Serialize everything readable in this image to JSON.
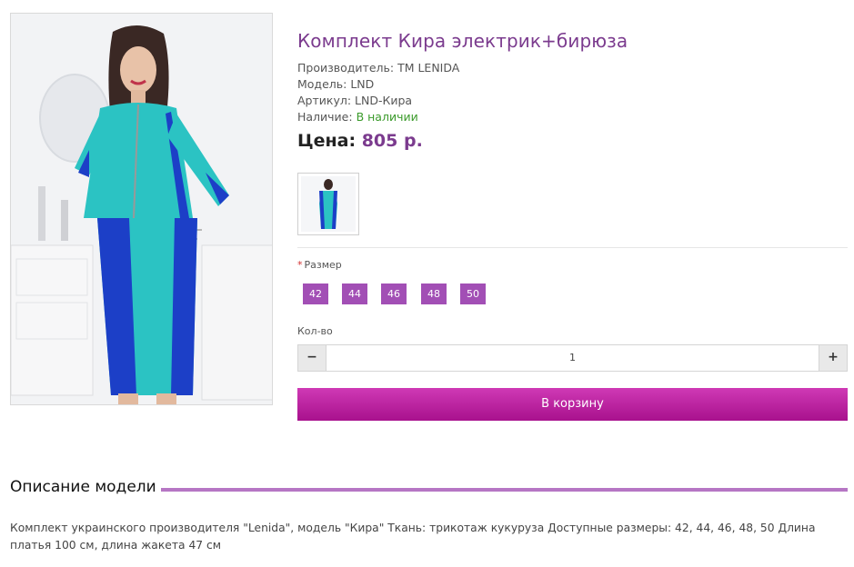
{
  "product": {
    "title": "Комплект Кира электрик+бирюза",
    "manufacturer_label": "Производитель:",
    "manufacturer": "TM LENIDA",
    "model_label": "Модель:",
    "model": "LND",
    "sku_label": "Артикул:",
    "sku": "LND-Кира",
    "availability_label": "Наличие:",
    "availability": "В наличии",
    "price_label": "Цена:",
    "price": "805 р."
  },
  "options": {
    "required_mark": "*",
    "size_label": "Размер",
    "sizes": [
      "42",
      "44",
      "46",
      "48",
      "50"
    ]
  },
  "quantity": {
    "label": "Кол-во",
    "value": "1",
    "minus_icon": "minus-icon",
    "plus_icon": "plus-icon"
  },
  "cart": {
    "button_label": "В корзину"
  },
  "description": {
    "heading": "Описание модели",
    "text": "Комплект украинского производителя \"Lenida\", модель \"Кира\" Ткань: трикотаж кукуруза Доступные размеры: 42, 44, 46, 48, 50 Длина платья 100 см, длина жакета 47 см"
  },
  "colors": {
    "accent_purple": "#7b3b8e",
    "size_button": "#a24fb5",
    "cart_button": "#c12aa6",
    "in_stock": "#3a9a2a",
    "dress_turquoise": "#2bc3c3",
    "dress_blue": "#1c3fc7"
  }
}
